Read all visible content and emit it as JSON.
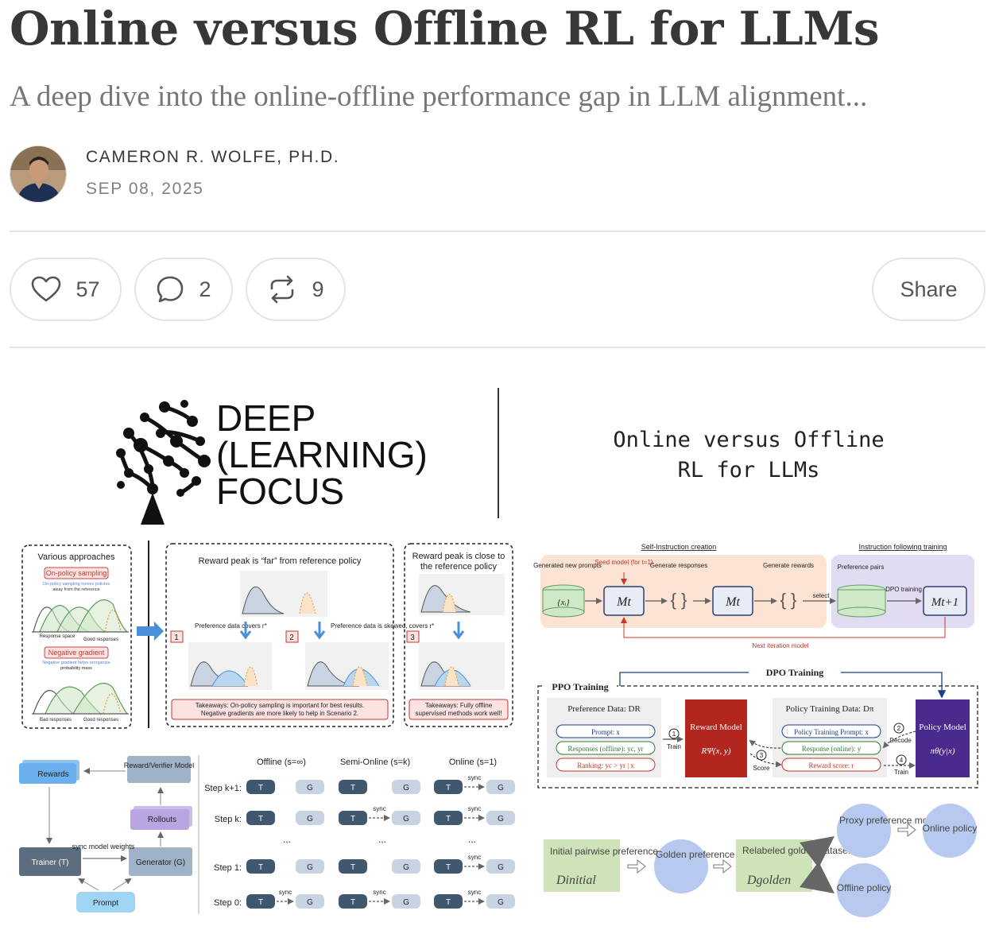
{
  "post": {
    "title": "Online versus Offline RL for LLMs",
    "subtitle": "A deep dive into the online-offline performance gap in LLM alignment...",
    "author": "CAMERON R. WOLFE, PH.D.",
    "date": "SEP 08, 2025"
  },
  "actions": {
    "likes": "57",
    "comments": "2",
    "restacks": "9",
    "share_label": "Share",
    "icons": [
      "heart-icon",
      "comment-icon",
      "restack-icon"
    ]
  },
  "cover": {
    "logo_lines": [
      "DEEP",
      "(LEARNING)",
      "FOCUS"
    ],
    "cover_title_lines": [
      "Online versus Offline",
      "RL for LLMs"
    ],
    "fig1": {
      "panel_a_title": "Various approaches",
      "on_policy_label": "On-policy sampling",
      "on_policy_note_1": "On-policy sampling moves policies",
      "on_policy_note_2": "away from the reference",
      "negative_gradient_label": "Negative gradient",
      "negative_gradient_note_1": "Negative gradient helps reorganize",
      "negative_gradient_note_2": "probability mass",
      "response_space": "Response space",
      "good_responses": "Good responses",
      "bad_responses": "Bad responses",
      "prob_mass": "Probability Mass",
      "panel_b_title": "Reward peak is “far” from reference policy",
      "pref_covers": "Preference data covers r*",
      "pref_skewed": "Preference data is skewed, covers r*",
      "panel_c_title_1": "Reward peak is close to",
      "panel_c_title_2": "the reference policy",
      "takeaway_b_1": "Takeaways: On-policy sampling is important for best results.",
      "takeaway_b_2": "Negative gradients are more likely to help in Scenario 2.",
      "takeaway_c_1": "Takeaways: Fully offline",
      "takeaway_c_2": "supervised methods work well!",
      "scenario_numbers": [
        "1",
        "2",
        "3"
      ]
    },
    "fig2": {
      "rewards": "Rewards",
      "reward_model": "Reward/Verifier Model",
      "rollouts": "Rollouts",
      "trainer": "Trainer (T)",
      "generator": "Generator (G)",
      "sync_weights": "sync model weights",
      "prompt": "Prompt",
      "columns": [
        "Offline (s=∞)",
        "Semi-Online (s=k)",
        "Online (s=1)"
      ],
      "rows": [
        "Step k+1:",
        "Step k:",
        "Step 1:",
        "Step 0:"
      ],
      "t": "T",
      "g": "G",
      "sync": "sync",
      "ellipsis": "..."
    },
    "fig3": {
      "self_instruction": "Self-Instruction creation",
      "instruction_training": "Instruction following training",
      "generated_prompts": "Generated new prompts",
      "seed_model": "Seed model (for t=1)",
      "generate_responses": "Generate responses",
      "generate_rewards": "Generate rewards",
      "preference_pairs": "Preference pairs",
      "dpo_training": "DPO training",
      "select": "select",
      "next_iteration": "Next iteration model",
      "model_t": "Mt",
      "model_t1": "Mt+1"
    },
    "fig4": {
      "ppo_training": "PPO Training",
      "dpo_training": "DPO Training",
      "preference_data": "Preference Data: DR",
      "prompt": "Prompt: x",
      "responses": "Responses (offline): yc, yr",
      "ranking": "Ranking: yc > yr | x",
      "reward_model": "Reward Model",
      "reward_formula": "RΨ(x, y)",
      "policy_training_data": "Policy Training Data: Dπ",
      "policy_prompt": "Policy Training Prompt: x",
      "response_online": "Response (online): y",
      "reward_score": "Reward score: r",
      "policy_model": "Policy Model",
      "policy_formula": "πθ(y|x)",
      "train": "Train",
      "decode": "Decode",
      "score": "Score",
      "steps": [
        "1",
        "2",
        "3",
        "4"
      ]
    },
    "fig5": {
      "initial": "Initial pairwise preference",
      "d_initial": "Dinitial",
      "golden_model": "Golden preference model",
      "relabeled": "Relabeled golden dataset",
      "d_golden": "Dgolden",
      "proxy": "Proxy preference model",
      "online_policy": "Online policy",
      "offline_policy": "Offline policy"
    }
  }
}
